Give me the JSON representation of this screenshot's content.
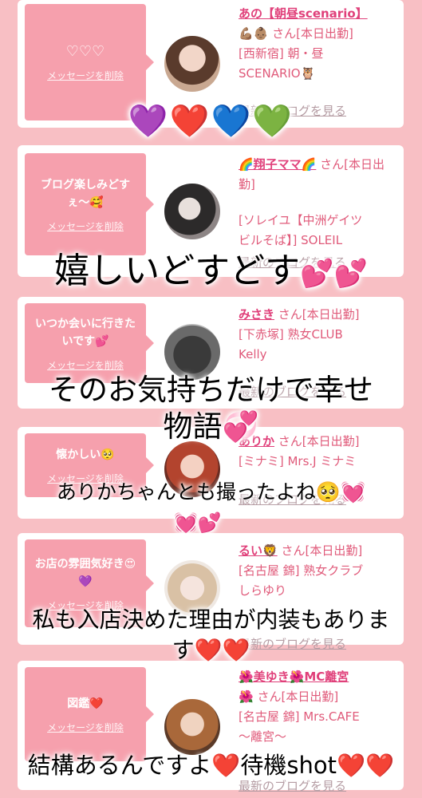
{
  "delete_label": "メッセージを削除",
  "blog_label": "最新のブログを見る",
  "cards": [
    {
      "message": "♡♡♡",
      "name": "あの【朝昼scenario】",
      "emoji": "💪🏽👶🏽",
      "suffix": "さん[本日出勤]",
      "shop_line1": "[西新宿] 朝・昼",
      "shop_line2": "SCENARIO🦉"
    },
    {
      "message": "ブログ楽しみどすぇ〜🥰",
      "name": "🌈翔子ママ🌈",
      "suffix": "さん[本日出勤]",
      "shop_line1": "[ソレイユ【中洲ゲイツ",
      "shop_line2": "ビルそば】] SOLEIL"
    },
    {
      "message": "いつか会いに行きたいです💕",
      "name": "みさき",
      "suffix": "さん[本日出勤]",
      "shop_line1": "[下赤塚] 熟女CLUB",
      "shop_line2": "Kelly"
    },
    {
      "message": "懐かしい🥺",
      "name": "ありか",
      "suffix": "さん[本日出勤]",
      "shop_line1": "[ミナミ] Mrs.J ミナミ",
      "shop_line2": ""
    },
    {
      "message": "お店の雰囲気好き😍💜",
      "name": "るい🦁",
      "suffix": "さん[本日出勤]",
      "shop_line1": "[名古屋 錦] 熟女クラブ",
      "shop_line2": "しらゆり"
    },
    {
      "message": "図鑑❤️",
      "name": "🌺美ゆき🌺MC離宮",
      "emoji": "🌺",
      "suffix": "さん[本日出勤]",
      "shop_line1": "[名古屋 錦] Mrs.CAFE",
      "shop_line2": "〜離宮〜"
    }
  ],
  "overlays": {
    "hearts_row": "💜❤️💙💚",
    "line1": "嬉しいどすどす",
    "line1_emoji": "💕💕",
    "line2a": "そのお気持ちだけで幸せ",
    "line2b": "物語💞",
    "line3": "ありかちゃんとも撮ったよね🥺💓",
    "line3_emoji": "💓💕",
    "line4a": "私も入店決めた理由が内装もありま",
    "line4b": "す❤️❤️",
    "line5": "結構あるんですよ❤️待機shot❤️❤️"
  }
}
